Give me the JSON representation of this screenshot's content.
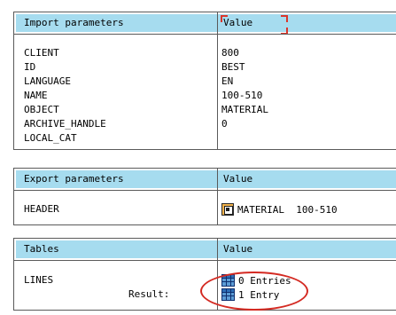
{
  "import_panel": {
    "header_left": "Import parameters",
    "header_right": "Value",
    "rows": [
      {
        "name": "CLIENT",
        "value": "800"
      },
      {
        "name": "ID",
        "value": "BEST"
      },
      {
        "name": "LANGUAGE",
        "value": "EN"
      },
      {
        "name": "NAME",
        "value": "100-510"
      },
      {
        "name": "OBJECT",
        "value": "MATERIAL"
      },
      {
        "name": "ARCHIVE_HANDLE",
        "value": "0"
      },
      {
        "name": "LOCAL_CAT",
        "value": ""
      }
    ]
  },
  "export_panel": {
    "header_left": "Export parameters",
    "header_right": "Value",
    "rows": [
      {
        "name": "HEADER",
        "value": "MATERIAL  100-510",
        "icon": "structure-icon"
      }
    ]
  },
  "tables_panel": {
    "header_left": "Tables",
    "header_right": "Value",
    "rows": [
      {
        "name": "LINES",
        "value": "0 Entries",
        "icon": "table-icon"
      },
      {
        "name": "Result:",
        "value": "1 Entry",
        "icon": "table-icon"
      }
    ]
  },
  "colors": {
    "header_bg": "#a6dcef",
    "border": "#5a5a5a",
    "highlight_oval": "#d42a22"
  }
}
